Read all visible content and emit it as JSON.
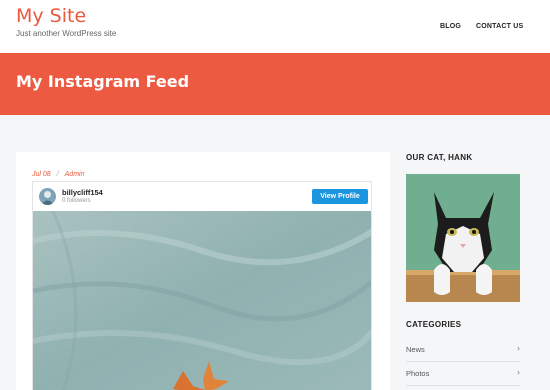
{
  "header": {
    "site_title": "My Site",
    "tagline": "Just another WordPress site",
    "nav": [
      "BLOG",
      "CONTACT US"
    ]
  },
  "hero": {
    "title": "My Instagram Feed"
  },
  "post": {
    "date": "Jul 08",
    "separator": "/",
    "author": "Admin"
  },
  "instagram": {
    "username": "billycliff154",
    "followers": "0 followers",
    "button_label": "View Profile"
  },
  "sidebar": {
    "cat_widget_title": "OUR CAT, HANK",
    "categories_title": "CATEGORIES",
    "categories": [
      {
        "label": "News",
        "icon": "chevron-right-icon"
      },
      {
        "label": "Photos",
        "icon": "chevron-right-icon"
      }
    ]
  },
  "colors": {
    "accent": "#e85a3e",
    "hero_bg": "#ec5a42",
    "button_blue": "#1b95e0"
  }
}
